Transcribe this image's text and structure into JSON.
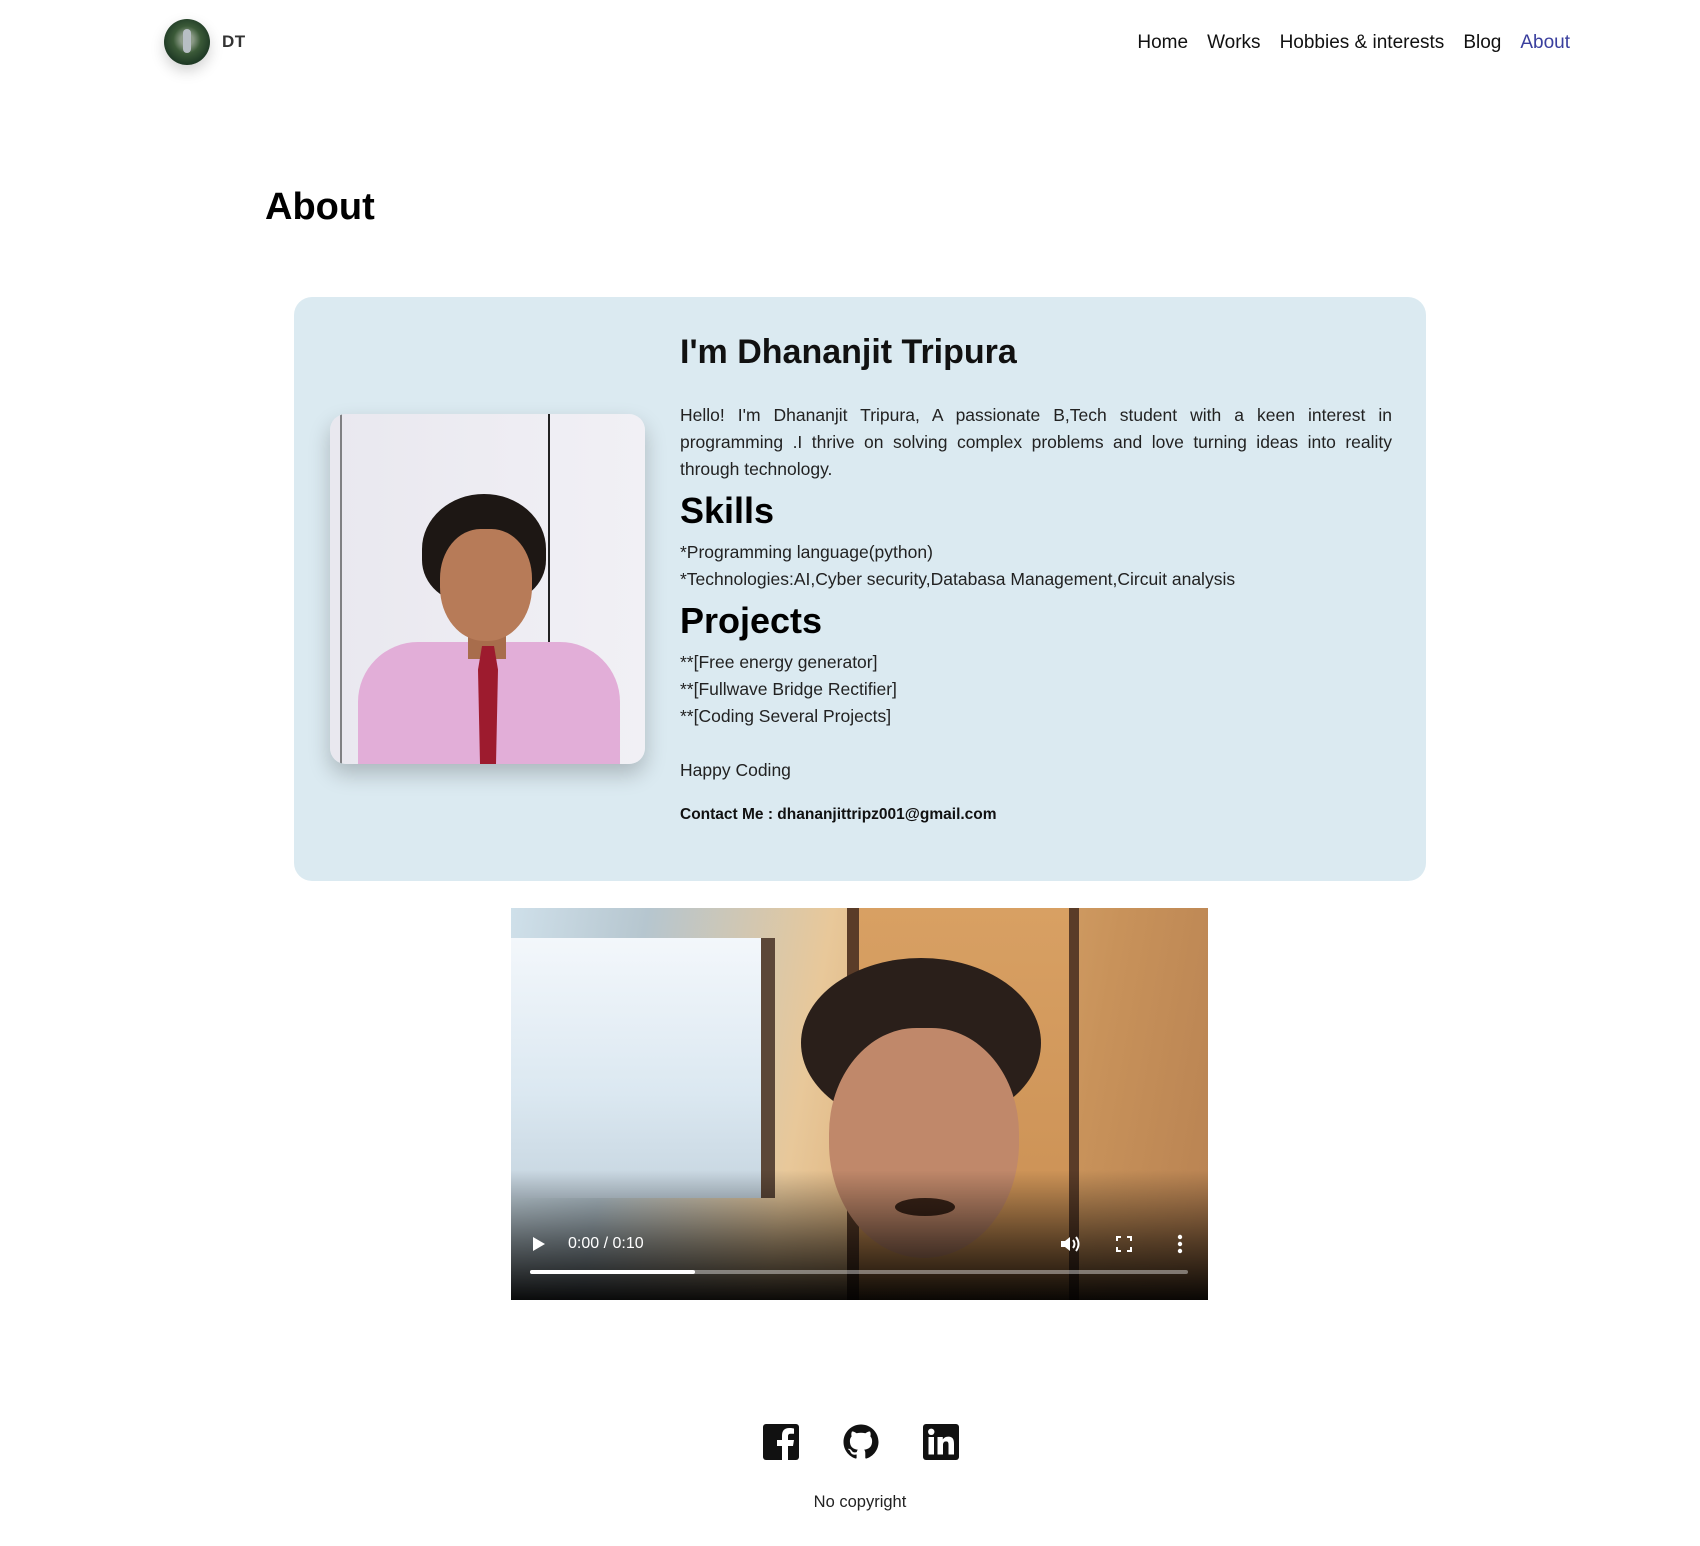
{
  "header": {
    "brand": "DT",
    "nav": [
      "Home",
      "Works",
      "Hobbies & interests",
      "Blog",
      "About"
    ],
    "active": "About",
    "accent_color": "#3a3f9e"
  },
  "page_title": "About",
  "card": {
    "name": "I'm Dhananjit Tripura",
    "bio": "Hello! I'm Dhananjit Tripura, A passionate B,Tech student with a keen interest in programming .I thrive on solving complex problems and love turning ideas into reality through technology.",
    "skills_heading": "Skills",
    "skills": [
      "*Programming language(python)",
      "*Technologies:AI,Cyber security,Databasa Management,Circuit analysis"
    ],
    "projects_heading": "Projects",
    "projects": [
      "**[Free energy generator]",
      "**[Fullwave Bridge Rectifier]",
      "**[Coding Several Projects]"
    ],
    "closing": "Happy Coding",
    "contact": "Contact Me : dhananjittripz001@gmail.com",
    "background_color": "#dbeaf1"
  },
  "video": {
    "time": "0:00 / 0:10",
    "progress_fraction": 0.25,
    "controls": [
      "play-icon",
      "volume-icon",
      "fullscreen-icon",
      "more-options-icon"
    ]
  },
  "footer": {
    "social_icons": [
      "facebook-icon",
      "github-icon",
      "linkedin-icon"
    ],
    "copyright": "No copyright"
  }
}
